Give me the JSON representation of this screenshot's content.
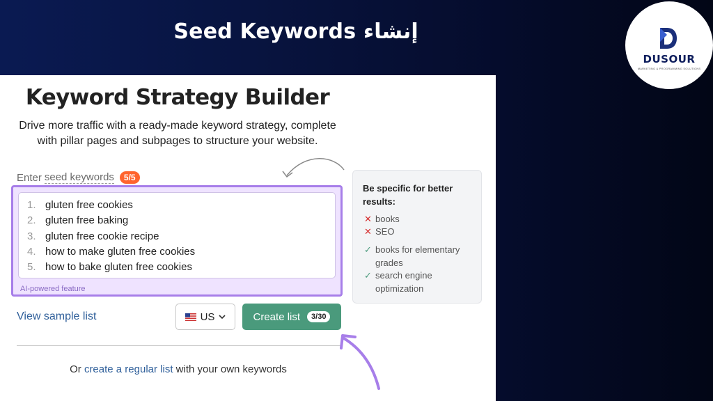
{
  "slide": {
    "title": "Seed Keywords إنشاء"
  },
  "logo": {
    "name": "DUSOUR",
    "tagline": "Marketing & Programming Solutions",
    "brand_color": "#0d1d5c"
  },
  "builder": {
    "title": "Keyword Strategy Builder",
    "subtitle": "Drive more traffic with a ready-made keyword strategy, complete with pillar pages and subpages to structure your website.",
    "seed_label_prefix": "Enter",
    "seed_label_link": "seed keywords",
    "seed_count": "5/5",
    "keywords": [
      {
        "num": "1.",
        "text": "gluten free cookies"
      },
      {
        "num": "2.",
        "text": "gluten free baking"
      },
      {
        "num": "3.",
        "text": "gluten free cookie recipe"
      },
      {
        "num": "4.",
        "text": "how to make gluten free cookies"
      },
      {
        "num": "5.",
        "text": "how to bake gluten free cookies"
      }
    ],
    "ai_caption": "AI-powered feature",
    "view_sample": "View sample list",
    "country": "US",
    "create_button": "Create list",
    "create_count": "3/30",
    "footer": {
      "prefix": "Or",
      "link": "create a regular list",
      "suffix": "with your own keywords"
    }
  },
  "tips": {
    "heading": "Be specific for better results:",
    "bad": [
      "books",
      "SEO"
    ],
    "good": [
      "books for elementary grades",
      "search engine optimization"
    ],
    "bad_icon": "x-icon",
    "good_icon": "check-icon"
  },
  "colors": {
    "accent_green": "#4a9a7c",
    "highlight_purple": "#a77ee9",
    "badge_orange": "#ff642d",
    "link_blue": "#2f5f9a"
  }
}
